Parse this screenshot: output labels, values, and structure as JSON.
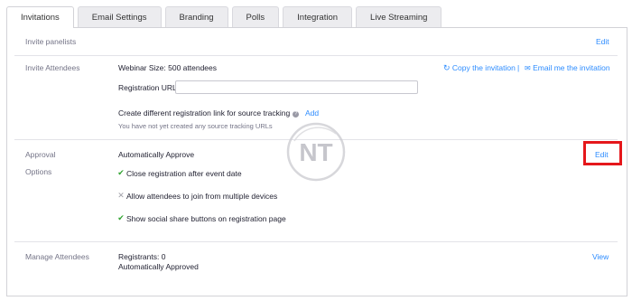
{
  "tabs": [
    {
      "label": "Invitations",
      "active": true
    },
    {
      "label": "Email Settings"
    },
    {
      "label": "Branding"
    },
    {
      "label": "Polls"
    },
    {
      "label": "Integration"
    },
    {
      "label": "Live Streaming"
    }
  ],
  "panelists": {
    "label": "Invite panelists",
    "edit": "Edit"
  },
  "attendees": {
    "label": "Invite Attendees",
    "webinar_size": "Webinar Size: 500 attendees",
    "copy_invitation": "Copy the invitation",
    "separator": "|",
    "email_invitation": "Email me the invitation",
    "registration_url_label": "Registration URL:",
    "registration_url_value": "",
    "source_tracking_label": "Create different registration link for source tracking",
    "source_tracking_add": "Add",
    "source_tracking_note": "You have not yet created any source tracking URLs"
  },
  "approval": {
    "label_line1": "Approval",
    "label_line2": "Options",
    "mode": "Automatically Approve",
    "edit": "Edit",
    "options": [
      {
        "label": "Close registration after event date",
        "enabled": true
      },
      {
        "label": "Allow attendees to join from multiple devices",
        "enabled": false
      },
      {
        "label": "Show social share buttons on registration page",
        "enabled": true
      }
    ]
  },
  "manage": {
    "label": "Manage Attendees",
    "registrants": "Registrants: 0",
    "status": "Automatically Approved",
    "view": "View"
  },
  "watermark": {
    "text": "NT"
  },
  "colors": {
    "link": "#2d8cff",
    "check": "#2fa32f",
    "highlight": "#e5171b"
  }
}
